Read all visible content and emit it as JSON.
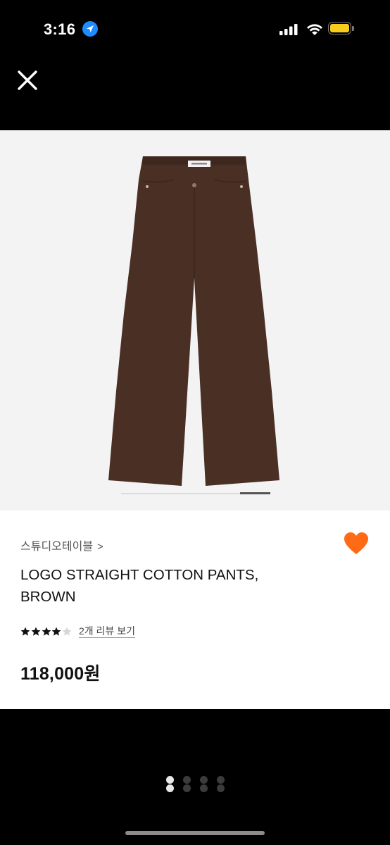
{
  "status_bar": {
    "time": "3:16",
    "icons": [
      "location-arrow-icon",
      "cellular-signal-icon",
      "wifi-icon",
      "battery-icon"
    ],
    "battery_color": "#f7cc1c"
  },
  "viewer": {
    "close_icon": "close-icon",
    "background": "#000000",
    "image_background": "#f3f3f3",
    "image_position": 0.8,
    "page_count": 4,
    "page_index_active": 0
  },
  "product": {
    "brand": "스튜디오테이블",
    "brand_chevron": ">",
    "title": "LOGO STRAIGHT COTTON PANTS, BROWN",
    "rating": 4,
    "rating_max": 5,
    "review_link": "2개 리뷰 보기",
    "price": "118,000원",
    "favorite_icon": "heart-icon",
    "favorite_color": "#ff6a14",
    "product_color": "#4a2f25"
  }
}
